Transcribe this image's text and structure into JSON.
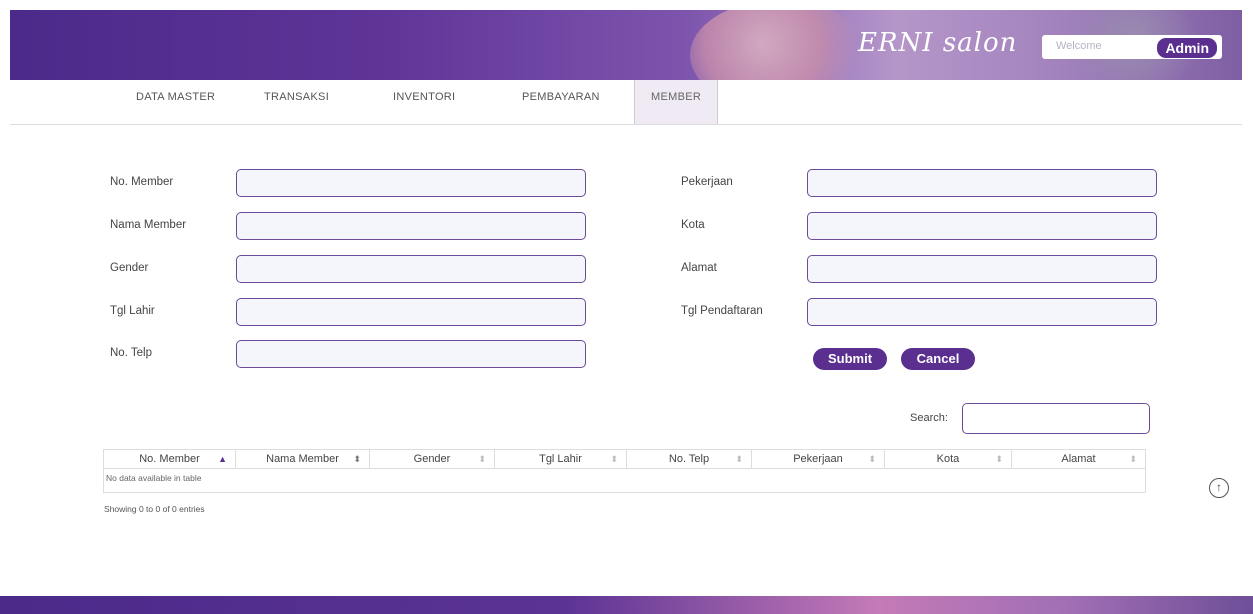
{
  "header": {
    "brand": "ERNI salon",
    "welcome": "Welcome",
    "user": "Admin"
  },
  "nav": {
    "items": [
      "DATA MASTER",
      "TRANSAKSI",
      "INVENTORI",
      "PEMBAYARAN",
      "MEMBER"
    ],
    "active": "MEMBER"
  },
  "form": {
    "left_labels": [
      "No. Member",
      "Nama Member",
      "Gender",
      "Tgl Lahir",
      "No. Telp"
    ],
    "right_labels": [
      "Pekerjaan",
      "Kota",
      "Alamat",
      "Tgl Pendaftaran"
    ],
    "submit": "Submit",
    "cancel": "Cancel"
  },
  "table": {
    "search_label": "Search:",
    "columns": [
      "No. Member",
      "Nama Member",
      "Gender",
      "Tgl Lahir",
      "No. Telp",
      "Pekerjaan",
      "Kota",
      "Alamat"
    ],
    "sort_column": "No. Member",
    "sort_direction": "asc",
    "empty": "No data available in table",
    "info": "Showing 0 to 0 of 0 entries"
  },
  "icons": {
    "scroll_top": "arrow-up-circle-icon"
  },
  "colors": {
    "accent": "#5a2f8f",
    "field_border": "#6b4a99",
    "field_bg": "#f4f6fb"
  }
}
